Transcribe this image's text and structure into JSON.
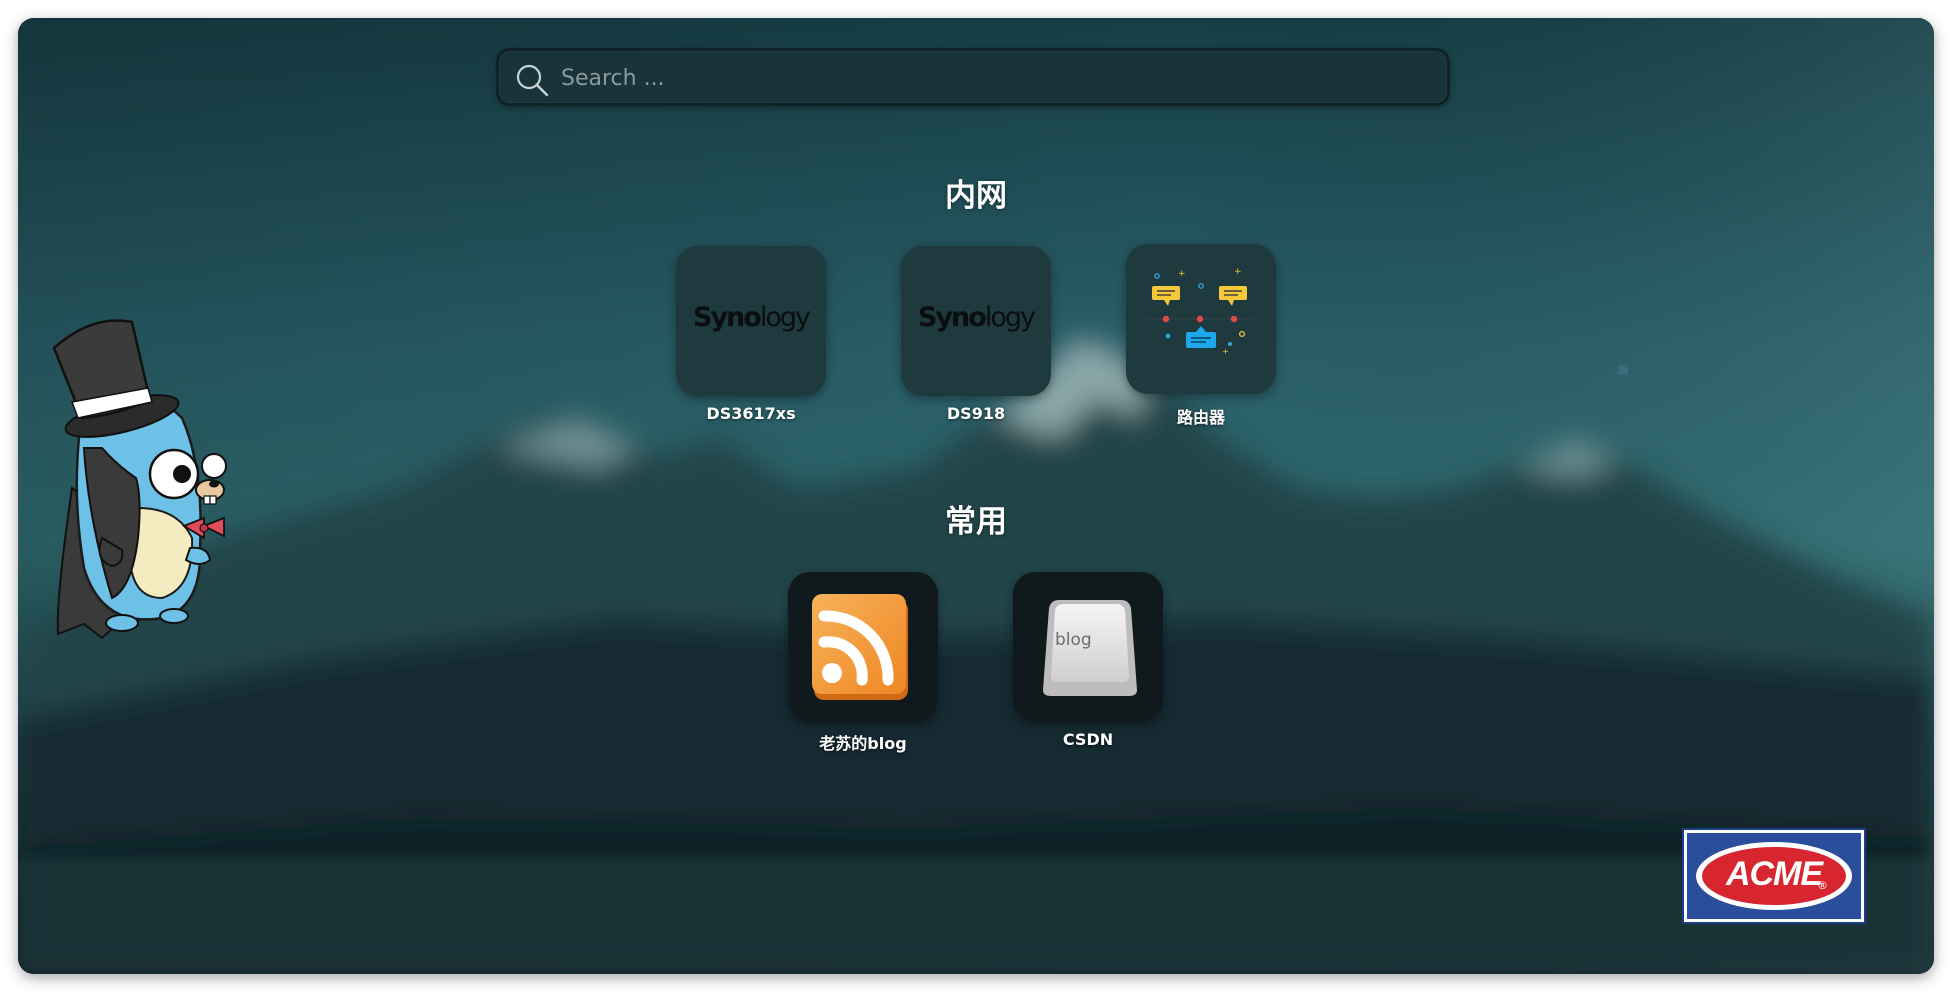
{
  "search": {
    "placeholder": "Search ..."
  },
  "groups": [
    {
      "title": "内网",
      "items": [
        {
          "label": "DS3617xs",
          "icon": "synology-logo-icon",
          "logo_text": [
            "Syno",
            "logy"
          ]
        },
        {
          "label": "DS918",
          "icon": "synology-logo-icon",
          "logo_text": [
            "Syno",
            "logy"
          ]
        },
        {
          "label": "路由器",
          "icon": "network-router-icon"
        }
      ]
    },
    {
      "title": "常用",
      "items": [
        {
          "label": "老苏的blog",
          "icon": "rss-feed-icon"
        },
        {
          "label": "CSDN",
          "icon": "blog-key-icon",
          "key_text": "blog"
        }
      ]
    }
  ],
  "decor": {
    "mascot": "go-gopher-top-hat-icon",
    "brand_badge": "ACME",
    "brand_mark": "®"
  },
  "colors": {
    "background_top": "#2a5f69",
    "background_bottom": "#0e2428",
    "rss_orange": "#f39a3a",
    "acme_red": "#d7262f",
    "acme_blue": "#2a4d9c"
  }
}
